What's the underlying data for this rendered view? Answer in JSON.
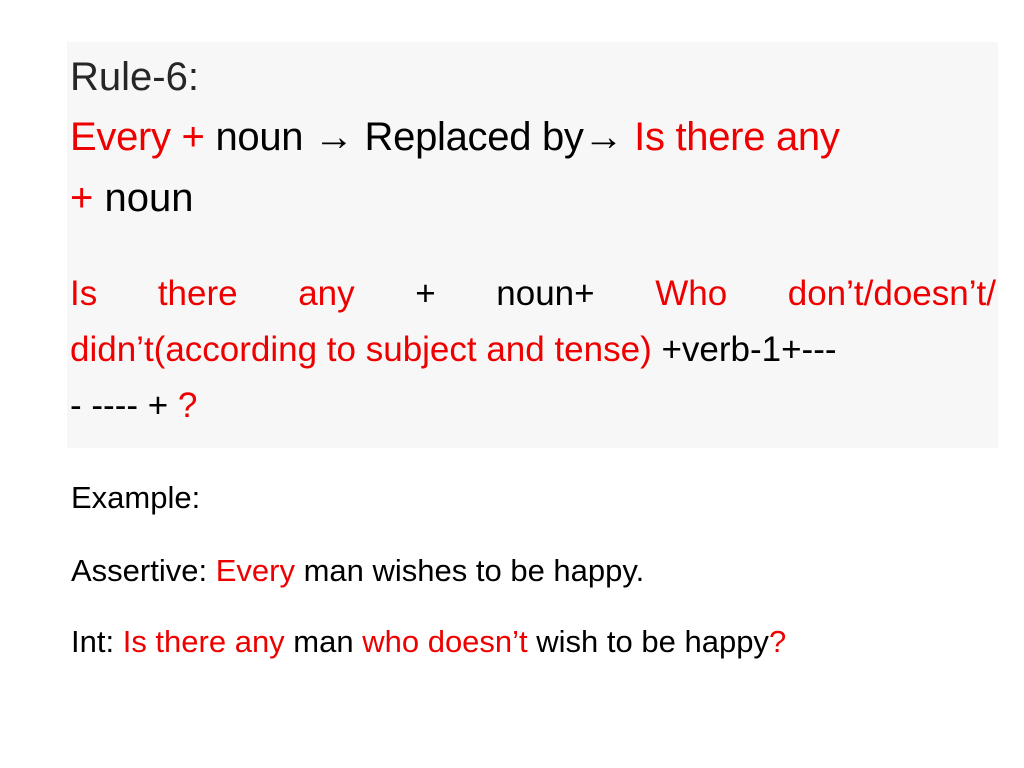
{
  "colors": {
    "accent_red": "#ee0000",
    "title_grey": "#262626",
    "box_background": "#f7f7f7",
    "text_black": "#000000"
  },
  "rule": {
    "title": "Rule-6:",
    "line1": {
      "every_plus": "Every +",
      "noun_arrow": " noun → Replaced by→ ",
      "is_there_any": "Is there any"
    },
    "line2": {
      "plus": "+",
      "noun": " noun"
    }
  },
  "pattern": {
    "line1": {
      "is": "Is",
      "there": "there",
      "any": "any",
      "plus": "+",
      "noun_plus": "noun+",
      "who": "Who",
      "dont": "don’t/doesn’t/"
    },
    "line2": {
      "didnt": "didn’t(according to subject and tense)",
      "verb": " +verb-1+---"
    },
    "line3": {
      "dashes": "- ---- + ",
      "question": "?"
    }
  },
  "example": {
    "heading": "Example:",
    "assertive": {
      "label": "Assertive: ",
      "every": "Every",
      "rest": " man wishes to be happy."
    },
    "int": {
      "label": "Int: ",
      "is_there_any": "Is there any",
      "man": " man ",
      "who_doesnt": "who doesn’t",
      "rest": " wish to be happy",
      "question": "?"
    }
  }
}
